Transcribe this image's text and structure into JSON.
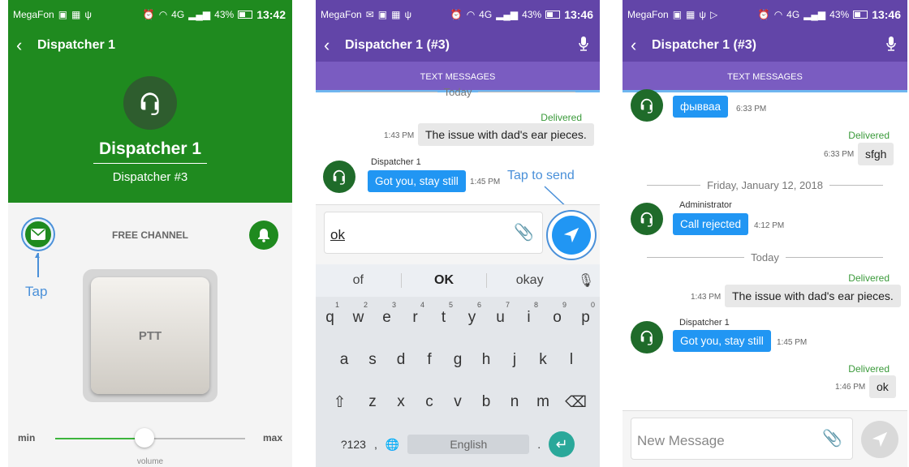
{
  "phone1": {
    "status": {
      "carrier": "MegaFon",
      "network": "4G",
      "battery": "43%",
      "time": "13:42"
    },
    "appbar_title": "Dispatcher 1",
    "hero": {
      "name": "Dispatcher 1",
      "subtitle": "Dispatcher #3"
    },
    "channel": "FREE CHANNEL",
    "tap_label": "Tap",
    "ptt_label": "PTT",
    "volume": {
      "min": "min",
      "max": "max",
      "label": "volume",
      "level": 0.47
    },
    "colors": {
      "primary": "#1f8a1f"
    }
  },
  "phone2": {
    "status": {
      "carrier": "MegaFon",
      "network": "4G",
      "battery": "43%",
      "time": "13:46"
    },
    "appbar_title": "Dispatcher 1 (#3)",
    "tab": "TEXT MESSAGES",
    "day_today": "Today",
    "out_msg": {
      "status": "Delivered",
      "time": "1:43 PM",
      "text": "The issue with dad's ear pieces."
    },
    "in_msg": {
      "sender": "Dispatcher 1",
      "text": "Got you, stay still",
      "time": "1:45 PM"
    },
    "annotation": "Tap to send",
    "input_value": "ok",
    "suggestions": [
      "of",
      "OK",
      "okay"
    ],
    "keyboard": {
      "row1": [
        [
          "q",
          "1"
        ],
        [
          "w",
          "2"
        ],
        [
          "e",
          "3"
        ],
        [
          "r",
          "4"
        ],
        [
          "t",
          "5"
        ],
        [
          "y",
          "6"
        ],
        [
          "u",
          "7"
        ],
        [
          "i",
          "8"
        ],
        [
          "o",
          "9"
        ],
        [
          "p",
          "0"
        ]
      ],
      "row2": [
        "a",
        "s",
        "d",
        "f",
        "g",
        "h",
        "j",
        "k",
        "l"
      ],
      "row3": [
        "z",
        "x",
        "c",
        "v",
        "b",
        "n",
        "m"
      ],
      "sym_key": "?123",
      "comma": ",",
      "space_label": "English",
      "period": "."
    },
    "colors": {
      "primary": "#6245a8",
      "bubble": "#2196f3",
      "send": "#2196f3"
    }
  },
  "phone3": {
    "status": {
      "carrier": "MegaFon",
      "network": "4G",
      "battery": "43%",
      "time": "13:46"
    },
    "appbar_title": "Dispatcher 1 (#3)",
    "tab": "TEXT MESSAGES",
    "msg_top": {
      "text": "фывваа",
      "time": "6:33 PM"
    },
    "out1": {
      "status": "Delivered",
      "time": "6:33 PM",
      "text": "sfgh"
    },
    "day1": "Friday, January 12, 2018",
    "admin_msg": {
      "sender": "Administrator",
      "text": "Call rejected",
      "time": "4:12 PM"
    },
    "day2": "Today",
    "out2": {
      "status": "Delivered",
      "time": "1:43 PM",
      "text": "The issue with dad's ear pieces."
    },
    "disp_msg": {
      "sender": "Dispatcher 1",
      "text": "Got you, stay still",
      "time": "1:45 PM"
    },
    "out3": {
      "status": "Delivered",
      "time": "1:46 PM",
      "text": "ok"
    },
    "input_placeholder": "New Message"
  }
}
